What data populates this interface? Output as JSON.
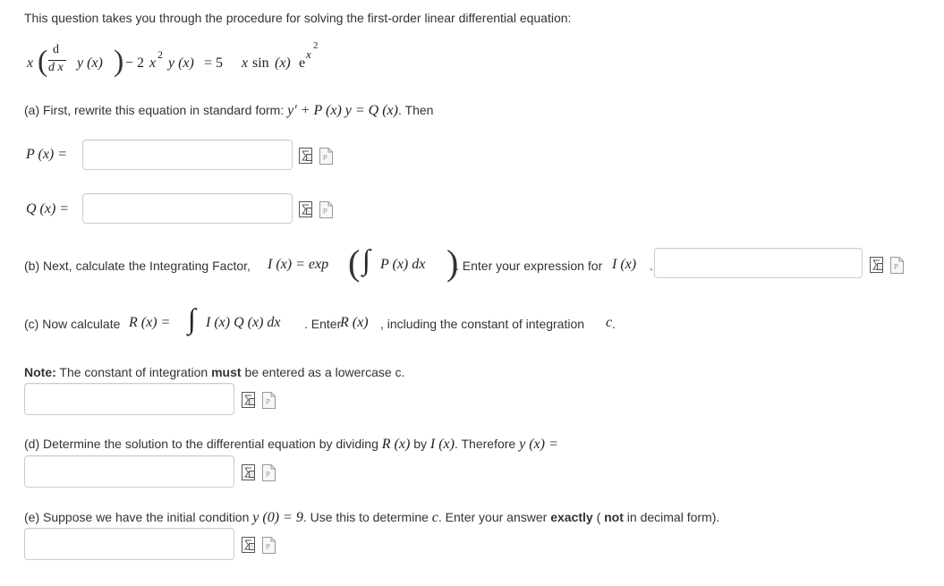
{
  "intro": "This question takes you through the procedure for solving the first-order linear differential equation:",
  "equation": {
    "x": "x",
    "d_top": "d",
    "d_bottom": "d x",
    "y_of_x": "y (x)",
    "minus": "− 2",
    "x2": "x",
    "sup2": "2",
    "y_of_x_2": "y (x)",
    "eq_rhs": "= 5",
    "x_rhs": "x",
    "sin": "sin",
    "arg": "(x)",
    "e": "e",
    "exp_x": "x",
    "exp_2": "2"
  },
  "part_a": {
    "text": "(a) First, rewrite this equation in standard form:",
    "standard_form": "y′ + P (x) y = Q (x)",
    "then": ". Then",
    "p_label": "P (x) =",
    "q_label": "Q (x) ="
  },
  "part_b": {
    "text": "(b) Next, calculate the Integrating Factor,",
    "ifactor": "I (x) = exp",
    "integral": "∫",
    "px_dx": "P (x)  dx",
    "enter": ". Enter your expression for",
    "ix": "I (x)",
    "dot": "."
  },
  "part_c": {
    "text": "(c) Now calculate",
    "rx_eq": "R (x) =",
    "integral": "∫",
    "integrand": "I (x) Q (x)  dx",
    "enter": ". Enter",
    "rx": "R (x)",
    "including": ", including the constant of integration",
    "c": "c",
    "dot": "."
  },
  "note": {
    "label": "Note:",
    "text1": "The constant of integration",
    "must": "must",
    "text2": "be entered as a lowercase c."
  },
  "part_d": {
    "text": "(d) Determine the solution to the differential equation by dividing",
    "rx": "R (x)",
    "by": "by",
    "ix": "I (x)",
    "therefore": ". Therefore",
    "yx": "y (x) ="
  },
  "part_e": {
    "text": "(e) Suppose we have the initial condition",
    "cond": "y (0) = 9",
    "use": ". Use this to determine",
    "c": "c",
    "enter": ". Enter your answer",
    "exactly": "exactly",
    "paren_open": "(",
    "not": "not",
    "paren_close": "in decimal form)."
  },
  "colors": {
    "border": "#cccccc",
    "text": "#333333",
    "icon": "#555555"
  },
  "icons": [
    "equation-editor-icon",
    "preview-icon"
  ]
}
